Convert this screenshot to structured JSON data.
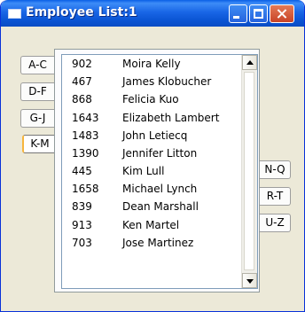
{
  "window": {
    "title": "Employee List:1"
  },
  "tabs": {
    "left": [
      "A-C",
      "D-F",
      "G-J",
      "K-M"
    ],
    "right": [
      "N-Q",
      "R-T",
      "U-Z"
    ],
    "active": "K-M"
  },
  "employees": [
    {
      "id": "902",
      "name": "Moira Kelly"
    },
    {
      "id": "467",
      "name": "James Klobucher"
    },
    {
      "id": "868",
      "name": "Felicia Kuo"
    },
    {
      "id": "1643",
      "name": "Elizabeth Lambert"
    },
    {
      "id": "1483",
      "name": "John Letiecq"
    },
    {
      "id": "1390",
      "name": "Jennifer Litton"
    },
    {
      "id": "445",
      "name": "Kim Lull"
    },
    {
      "id": "1658",
      "name": "Michael Lynch"
    },
    {
      "id": "839",
      "name": "Dean Marshall"
    },
    {
      "id": "913",
      "name": "Ken Martel"
    },
    {
      "id": "703",
      "name": "Jose Martinez"
    }
  ],
  "icons": {
    "scroll_up": "triangle-up-icon",
    "scroll_down": "triangle-down-icon"
  },
  "colors": {
    "titlebar": "#0b55d4",
    "window_bg": "#ece9d8",
    "active_tab_accent": "#f6b53d"
  }
}
